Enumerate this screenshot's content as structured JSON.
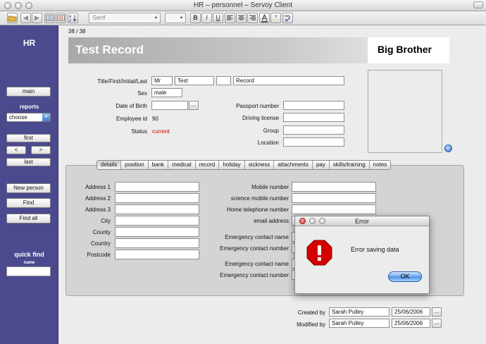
{
  "window": {
    "title": "HR – personnel – Servoy Client"
  },
  "toolbar": {
    "font_family": "Serif",
    "font_size": "",
    "undo_glyph": "↶",
    "back_glyph": "◀",
    "forward_glyph": "▶",
    "bold": "B",
    "italic": "I",
    "underline": "U",
    "font_color_glyph": "A",
    "spellcheck_label": "ABC"
  },
  "sidebar": {
    "title": "HR",
    "main_label": "main",
    "reports_label": "reports",
    "reports_select": "choose",
    "first_label": "first",
    "prev_label": "<",
    "next_label": ">",
    "last_label": "last",
    "new_person_label": "New person",
    "find_label": "Find",
    "find_all_label": "Find all",
    "quick_find_title": "quick find",
    "quick_find_sub": "name",
    "quick_find_value": ""
  },
  "record": {
    "counter": "38 / 38",
    "title": "Test Record",
    "brand": "Big Brother"
  },
  "person": {
    "name_label": "Title/First/Initial/Last",
    "title_value": "Mr",
    "first_value": "Test",
    "initial_value": "",
    "last_value": "Record",
    "sex_label": "Sex",
    "sex_value": "male",
    "dob_label": "Date of Birth",
    "dob_value": "",
    "dob_btn": "...",
    "employee_id_label": "Employee id",
    "employee_id_value": "90",
    "status_label": "Status",
    "status_value": "current",
    "passport_label": "Passport number",
    "passport_value": "",
    "license_label": "Driving license",
    "license_value": "",
    "group_label": "Group",
    "group_value": "",
    "location_label": "Location",
    "location_value": ""
  },
  "tabs": [
    "details",
    "position",
    "bank",
    "medical",
    "record",
    "holiday",
    "sickness",
    "attachments",
    "pay",
    "skills/training",
    "notes"
  ],
  "details": {
    "address_labels": [
      "Address 1",
      "Address 2",
      "Address 3",
      "City",
      "County",
      "Country",
      "Postcode"
    ],
    "address_values": [
      "",
      "",
      "",
      "",
      "",
      "",
      ""
    ],
    "contact_labels": [
      "Mobile number",
      "science mobile number",
      "Home telephone number",
      "email address",
      "Emergency contact name",
      "Emergency contact number",
      "Emergency contact name",
      "Emergency contact number"
    ],
    "contact_values": [
      "",
      "",
      "",
      "",
      "",
      "",
      "",
      ""
    ]
  },
  "audit": {
    "created_label": "Created by",
    "created_by": "Sarah Pulley",
    "created_date": "25/06/2006",
    "modified_label": "Modified by",
    "modified_by": "Sarah Pulley",
    "modified_date": "25/06/2006",
    "btn": "..."
  },
  "dialog": {
    "title": "Error",
    "message": "Error saving data",
    "ok_label": "OK"
  },
  "colors": {
    "sidebar": "#4b4a8f",
    "status_current": "#cc0000",
    "error_red": "#d40000",
    "ok_button": "#4c8fe0"
  }
}
